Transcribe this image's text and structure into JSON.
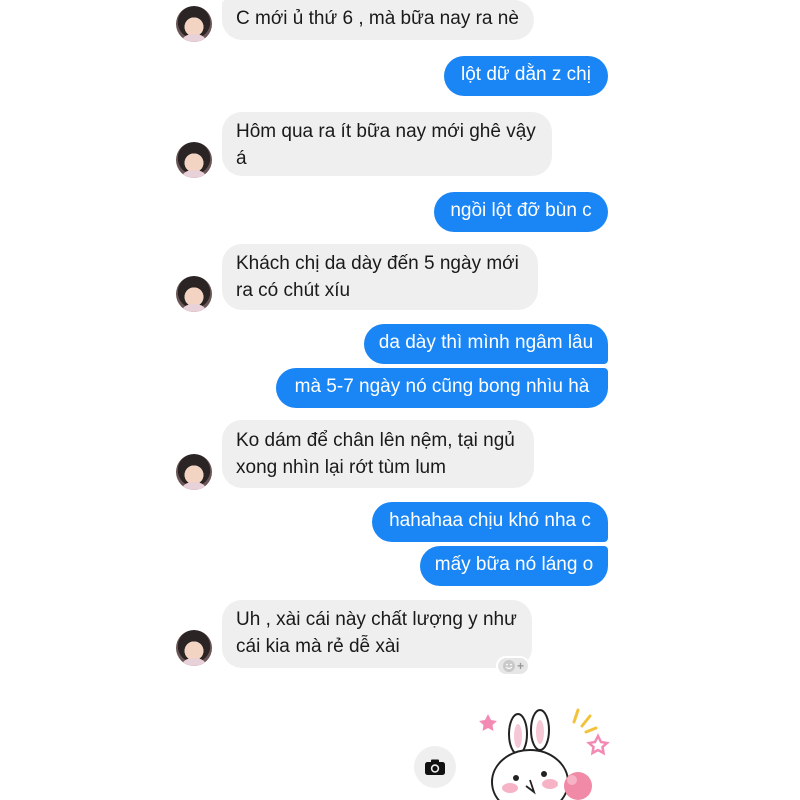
{
  "conversation": {
    "messages": [
      {
        "from": "them",
        "text": "C mới ủ thứ 6 , mà bữa nay ra nè"
      },
      {
        "from": "me",
        "text": "lột dữ dằn z chị"
      },
      {
        "from": "them",
        "text": "Hôm qua ra ít bữa nay mới ghê vậy\ná"
      },
      {
        "from": "me",
        "text": "ngồi lột đỡ bùn c"
      },
      {
        "from": "them",
        "text": "Khách chị da dày đến 5 ngày mới\nra có chút xíu"
      },
      {
        "from": "me",
        "text": "da dày thì mình ngâm lâu"
      },
      {
        "from": "me",
        "text": "mà 5-7 ngày nó cũng bong nhìu hà"
      },
      {
        "from": "them",
        "text": "Ko dám để chân lên nệm, tại ngủ\nxong nhìn lại rớt tùm lum"
      },
      {
        "from": "me",
        "text": "hahahaa chịu khó nha c"
      },
      {
        "from": "me",
        "text": "mấy bữa nó láng o"
      },
      {
        "from": "them",
        "text": "Uh , xài cái này chất lượng y như\ncái kia mà rẻ dễ xài"
      }
    ],
    "reaction_button": {
      "icon": "smile-plus-icon",
      "label": "+"
    },
    "camera_button": {
      "icon": "camera-icon"
    },
    "sticker": {
      "icon": "bunny-sticker"
    }
  },
  "colors": {
    "outgoing_bubble": "#1a86f5",
    "incoming_bubble": "#efefef",
    "background": "#ffffff"
  }
}
